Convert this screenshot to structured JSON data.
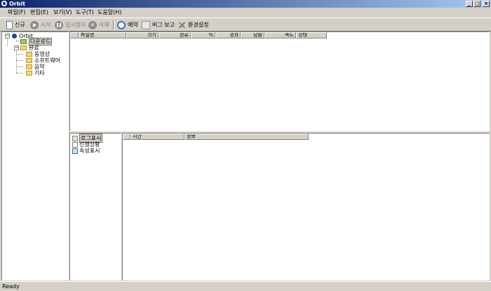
{
  "window": {
    "title": "Orbit"
  },
  "menu": {
    "items": [
      "파일(F)",
      "편집(E)",
      "보기(V)",
      "도구(T)",
      "도움말(H)"
    ]
  },
  "toolbar": {
    "new": "신규",
    "start": "시작",
    "pause": "일시정지",
    "delete": "삭제",
    "schedule": "예약",
    "bug_report": "버그 보고",
    "settings": "환경설정"
  },
  "tree": {
    "root": "Orbit",
    "download": "다운로드",
    "complete": "완료",
    "children": [
      "동영상",
      "소프트웨어",
      "음악",
      "기타"
    ]
  },
  "files_table": {
    "columns": [
      "파일명",
      "크기",
      "완료",
      "%",
      "경과",
      "남음",
      "속도",
      "상태"
    ]
  },
  "bottom_list": {
    "items": [
      "로그표시",
      "진행상황",
      "속성표시"
    ]
  },
  "log_table": {
    "columns": [
      "시간",
      "정보"
    ]
  },
  "status": {
    "text": "Ready"
  }
}
